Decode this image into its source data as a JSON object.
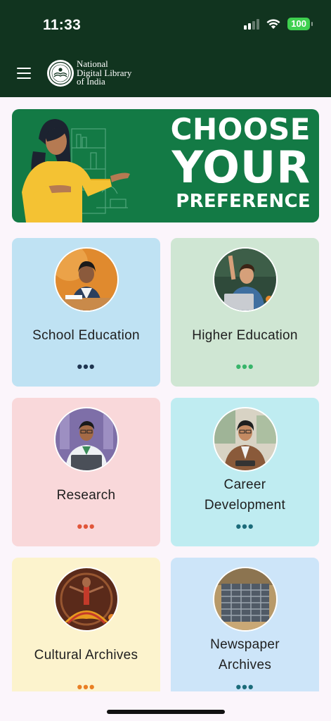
{
  "status_bar": {
    "time": "11:33",
    "battery": "100"
  },
  "header": {
    "logo_lines": [
      "National",
      "Digital Library",
      "of India"
    ]
  },
  "banner": {
    "line1": "CHOOSE",
    "line2": "YOUR",
    "line3": "PREFERENCE"
  },
  "categories": [
    {
      "label_lines": [
        "School Education"
      ],
      "dots": "•••",
      "dot_color": "#1f3550"
    },
    {
      "label_lines": [
        "Higher Education"
      ],
      "dots": "•••",
      "dot_color": "#38b56a"
    },
    {
      "label_lines": [
        "Research"
      ],
      "dots": "•••",
      "dot_color": "#e1563a"
    },
    {
      "label_lines": [
        "Career",
        "Development"
      ],
      "dots": "•••",
      "dot_color": "#1b6b7a"
    },
    {
      "label_lines": [
        "Cultural Archives"
      ],
      "dots": "•••",
      "dot_color": "#e97f24"
    },
    {
      "label_lines": [
        "Newspaper",
        "Archives"
      ],
      "dots": "•••",
      "dot_color": "#1b6b7a"
    }
  ],
  "colors": {
    "header_bg": "#11341f",
    "banner_bg": "#137a45",
    "battery": "#3fd050"
  }
}
